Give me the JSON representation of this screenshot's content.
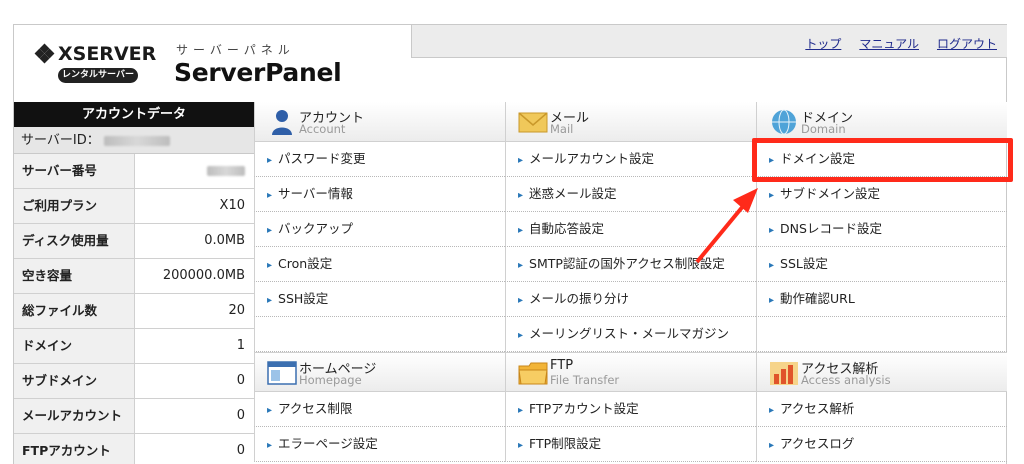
{
  "header": {
    "brand": "XSERVER",
    "rental_badge": "レンタルサーバー",
    "panel_kana": "サーバーパネル",
    "panel_title": "ServerPanel",
    "links": [
      "トップ",
      "マニュアル",
      "ログアウト"
    ]
  },
  "account": {
    "title": "アカウントデータ",
    "server_id_label": "サーバーID：",
    "rows": [
      {
        "label": "サーバー番号",
        "value": ""
      },
      {
        "label": "ご利用プラン",
        "value": "X10"
      },
      {
        "label": "ディスク使用量",
        "value": "0.0MB"
      },
      {
        "label": "空き容量",
        "value": "200000.0MB"
      },
      {
        "label": "総ファイル数",
        "value": "20"
      },
      {
        "label": "ドメイン",
        "value": "1"
      },
      {
        "label": "サブドメイン",
        "value": "0"
      },
      {
        "label": "メールアカウント",
        "value": "0"
      },
      {
        "label": "FTPアカウント",
        "value": "0"
      }
    ]
  },
  "sections": {
    "account": {
      "jp": "アカウント",
      "en": "Account",
      "items": [
        "パスワード変更",
        "サーバー情報",
        "バックアップ",
        "Cron設定",
        "SSH設定"
      ]
    },
    "mail": {
      "jp": "メール",
      "en": "Mail",
      "items": [
        "メールアカウント設定",
        "迷惑メール設定",
        "自動応答設定",
        "SMTP認証の国外アクセス制限設定",
        "メールの振り分け",
        "メーリングリスト・メールマガジン"
      ]
    },
    "domain": {
      "jp": "ドメイン",
      "en": "Domain",
      "items": [
        "ドメイン設定",
        "サブドメイン設定",
        "DNSレコード設定",
        "SSL設定",
        "動作確認URL"
      ]
    },
    "homepage": {
      "jp": "ホームページ",
      "en": "Homepage",
      "items": [
        "アクセス制限",
        "エラーページ設定"
      ]
    },
    "ftp": {
      "jp": "FTP",
      "en": "File Transfer",
      "items": [
        "FTPアカウント設定",
        "FTP制限設定"
      ]
    },
    "analysis": {
      "jp": "アクセス解析",
      "en": "Access analysis",
      "items": [
        "アクセス解析",
        "アクセスログ"
      ]
    }
  },
  "colors": {
    "highlight": "#ff2a1a",
    "link": "#1f2a8c",
    "arrow": "#2a78b8"
  },
  "icons": {
    "item_arrow": "▸"
  }
}
